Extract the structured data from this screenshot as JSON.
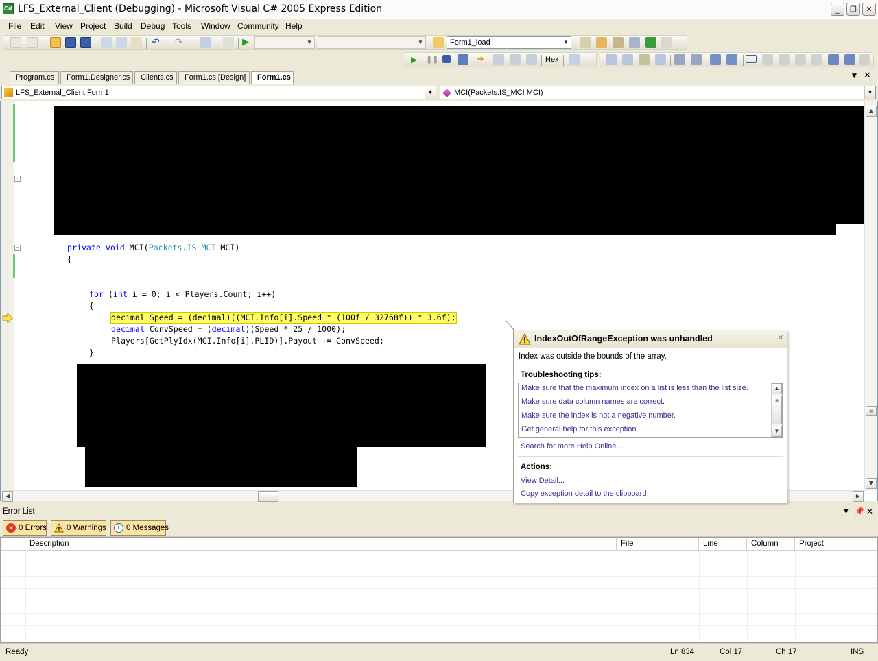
{
  "window": {
    "title": "LFS_External_Client (Debugging) - Microsoft Visual C# 2005 Express Edition",
    "app_icon": "csharp-icon"
  },
  "menu": [
    "File",
    "Edit",
    "View",
    "Project",
    "Build",
    "Debug",
    "Tools",
    "Window",
    "Community",
    "Help"
  ],
  "toolbar": {
    "find_combo_value": "Form1_load",
    "hex_label": "Hex"
  },
  "tabs": [
    "Program.cs",
    "Form1.Designer.cs",
    "Clients.cs",
    "Form1.cs [Design]",
    "Form1.cs"
  ],
  "active_tab": "Form1.cs",
  "nav": {
    "class_combo": "LFS_External_Client.Form1",
    "member_combo": "MCI(Packets.IS_MCI MCI)"
  },
  "code": {
    "line1": {
      "kw": "private void",
      "rest1": " MCI(",
      "ty1": "Packets",
      "dot": ".",
      "ty2": "IS_MCI",
      "rest2": " MCI)"
    },
    "line2": "{",
    "line3": {
      "kw1": "for",
      "p1": " (",
      "kw2": "int",
      "rest": " i = 0; i < Players.Count; i++)"
    },
    "line4": "{",
    "line5": "decimal Speed = (decimal)((MCI.Info[i].Speed * (100f / 32768f)) * 3.6f);",
    "line6": {
      "kw1": "decimal",
      "p1": " ConvSpeed = (",
      "kw2": "decimal",
      "rest": ")(Speed * 25 / 1000);"
    },
    "line7": "Players[GetPlyIdx(MCI.Info[i].PLID)].Payout += ConvSpeed;",
    "line8": "}"
  },
  "exception": {
    "title": "IndexOutOfRangeException was unhandled",
    "message": "Index was outside the bounds of the array.",
    "tips_title": "Troubleshooting tips:",
    "tips": [
      "Make sure that the maximum index on a list is less than the list size.",
      "Make sure data column names are correct.",
      "Make sure the index is not a negative number.",
      "Get general help for this exception."
    ],
    "search_link": "Search for more Help Online...",
    "actions_title": "Actions:",
    "view_detail": "View Detail...",
    "copy_detail": "Copy exception detail to the clipboard"
  },
  "error_list": {
    "title": "Error List",
    "errors": "0 Errors",
    "warnings": "0 Warnings",
    "messages": "0 Messages",
    "columns": [
      "",
      "Description",
      "File",
      "Line",
      "Column",
      "Project"
    ]
  },
  "status": {
    "state": "Ready",
    "ln": "Ln 834",
    "col": "Col 17",
    "ch": "Ch 17",
    "mode": "INS"
  },
  "colors": {
    "keyword": "#0000ff",
    "type": "#2b91af",
    "current_line": "#ffff66",
    "link": "#4a2b8e"
  }
}
